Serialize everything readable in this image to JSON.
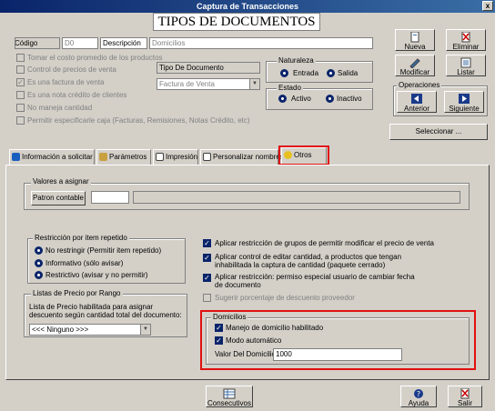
{
  "window": {
    "title": "Captura de Transacciones",
    "close": "x"
  },
  "heading": "TIPOS DE DOCUMENTOS",
  "form": {
    "codigo_label": "Código",
    "codigo_value": "D0",
    "descripcion_label": "Descripción",
    "descripcion_value": "Domicilios",
    "checks": [
      "Tomar el costo promedio de los productos",
      "Control de precios de venta",
      "Es una factura de venta",
      "Es una nota crédito de clientes",
      "No maneja cantidad",
      "Permitir especificarle caja  (Facturas, Remisiones, Notas Crédito, etc)"
    ],
    "tipo_doc_label": "Tipo De Documento",
    "tipo_doc_value": "Factura de Venta"
  },
  "naturaleza": {
    "title": "Naturaleza",
    "options": [
      "Entrada",
      "Salida"
    ]
  },
  "estado": {
    "title": "Estado",
    "options": [
      "Activo",
      "Inactivo"
    ]
  },
  "buttons": {
    "nueva": "Nueva",
    "eliminar": "Eliminar",
    "modificar": "Modificar",
    "listar": "Listar",
    "operaciones": "Operaciones",
    "anterior": "Anterior",
    "siguiente": "Siguiente",
    "seleccionar": "Seleccionar ...",
    "consecutivos": "Consecutivos",
    "ayuda": "Ayuda",
    "salir": "Salir"
  },
  "tabs": [
    "Información a solicitar",
    "Parámetros",
    "Impresión",
    "Personalizar nombres",
    "Otros"
  ],
  "valores": {
    "title": "Valores a asignar",
    "patron_label": "Patron contable",
    "value1": "",
    "value2": ""
  },
  "restriccion": {
    "title": "Restricción por item repetido",
    "options": [
      "No restringir  (Permitir item repetido)",
      "Informativo  (sólo avisar)",
      "Restrictivo  (avisar y no permitir)"
    ]
  },
  "listas": {
    "title": "Listas de Precio por Rango",
    "desc": "Lista de Precio habilitada para asignar descuento según cantidad total del documento:",
    "select_value": "<<< Ninguno >>>"
  },
  "right_checks": [
    "Aplicar restricción de grupos de permitir modificar el precio de venta",
    "Aplicar control de editar cantidad, a productos que tengan inhabilitada la captura de cantidad (paquete cerrado)",
    "Aplicar restricción: permiso especial usuario de cambiar fecha de documento",
    "Sugerir porcentaje de descuento proveedor"
  ],
  "domicilios": {
    "title": "Domicilios",
    "manejo": "Manejo de domicilio habilitado",
    "modo": "Modo automático",
    "valor_label": "Valor Del Domicilio",
    "valor": "1000"
  },
  "colors": {
    "titlebar": "#0a246a",
    "highlight": "#e01010",
    "face": "#d4d0c8"
  }
}
